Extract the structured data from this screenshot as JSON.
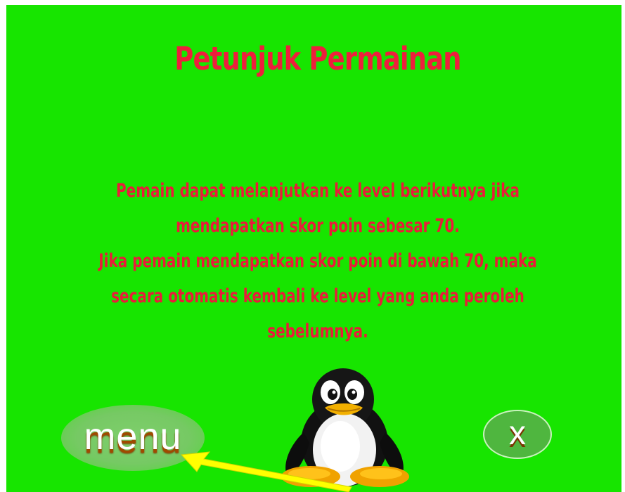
{
  "screen": {
    "title": "Petunjuk Permainan",
    "instructions": [
      "Pemain dapat melanjutkan ke level berikutnya jika",
      "mendapatkan skor poin sebesar  70.",
      "Jika pemain mendapatkan skor poin di bawah 70, maka",
      "secara otomatis kembali ke level yang anda peroleh",
      "sebelumnya."
    ]
  },
  "buttons": {
    "menu_label": "menu",
    "close_label": "x"
  },
  "colors": {
    "background": "#17e500",
    "text": "#e91c3a",
    "arrow": "#ffff00"
  },
  "icons": {
    "mascot": "penguin-icon",
    "pointer": "arrow-icon"
  }
}
